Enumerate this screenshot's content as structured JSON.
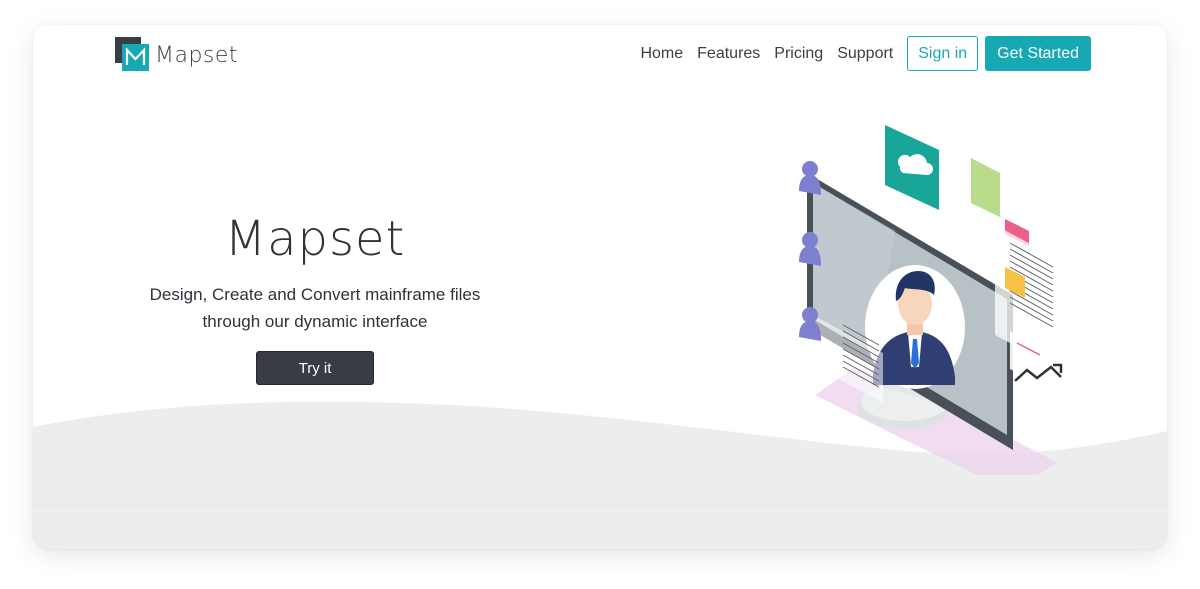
{
  "brand": {
    "name": "Mapset",
    "logo_icon": "mapset-logo-icon",
    "accent_color": "#16a8b3",
    "dark_color": "#373c45"
  },
  "nav": {
    "links": [
      "Home",
      "Features",
      "Pricing",
      "Support"
    ],
    "signin_label": "Sign in",
    "get_started_label": "Get Started"
  },
  "hero": {
    "title": "Mapset",
    "subtitle_line1": "Design, Create and Convert mainframe files",
    "subtitle_line2": "through our dynamic interface",
    "cta_label": "Try it",
    "illustration": "isometric-monitor-with-user-profile-illustration"
  }
}
